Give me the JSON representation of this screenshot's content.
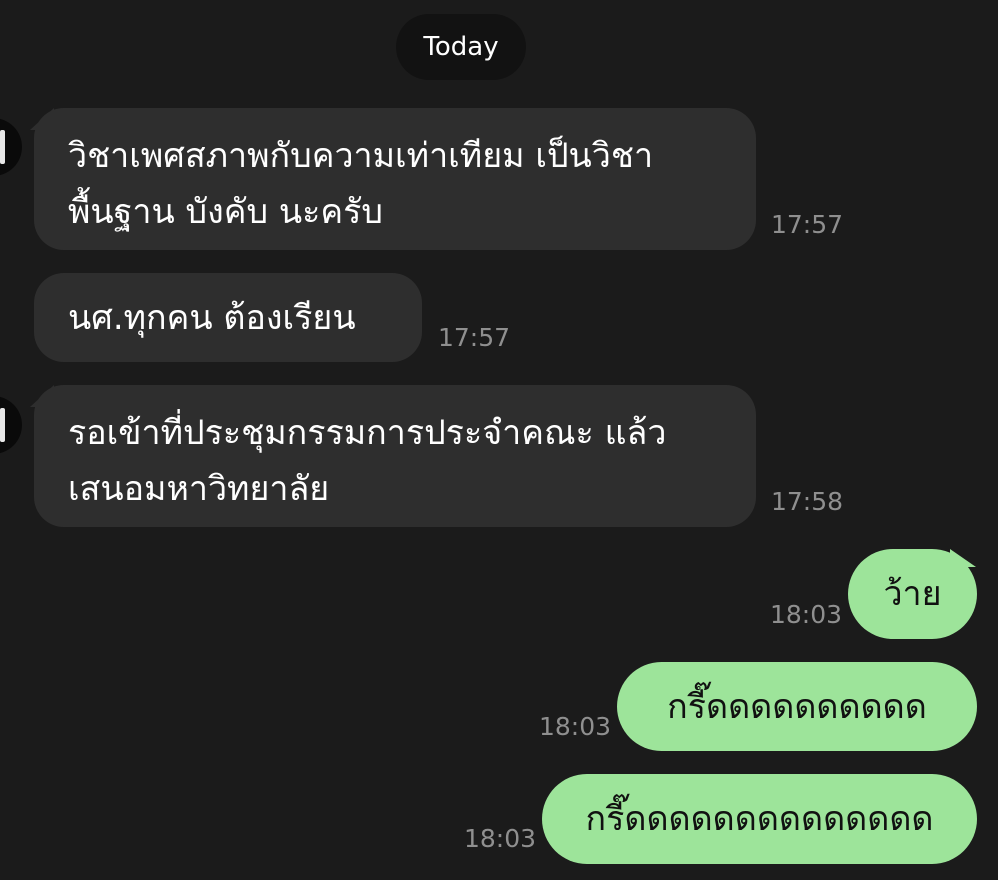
{
  "chat": {
    "date_label": "Today",
    "messages": [
      {
        "side": "incoming",
        "lines": [
          "วิชาเพศสภาพกับความเท่าเทียม เป็นวิชา",
          "พื้นฐาน บังคับ นะครับ"
        ],
        "time": "17:57"
      },
      {
        "side": "incoming",
        "lines": [
          "นศ.ทุกคน ต้องเรียน"
        ],
        "time": "17:57"
      },
      {
        "side": "incoming",
        "lines": [
          "รอเข้าที่ประชุมกรรมการประจำคณะ แล้ว",
          "เสนอมหาวิทยาลัย"
        ],
        "time": "17:58"
      },
      {
        "side": "outgoing",
        "lines": [
          "ว้าย"
        ],
        "time": "18:03"
      },
      {
        "side": "outgoing",
        "lines": [
          "กรี๊ดดดดดดดดดด"
        ],
        "time": "18:03"
      },
      {
        "side": "outgoing",
        "lines": [
          "กรี๊ดดดดดดดดดดดดดด"
        ],
        "time": "18:03"
      }
    ]
  },
  "colors": {
    "background": "#1b1b1b",
    "incoming_bubble": "#2e2e2e",
    "outgoing_bubble": "#9de49a",
    "timestamp": "#8f8f8f",
    "date_pill": "#121212"
  }
}
